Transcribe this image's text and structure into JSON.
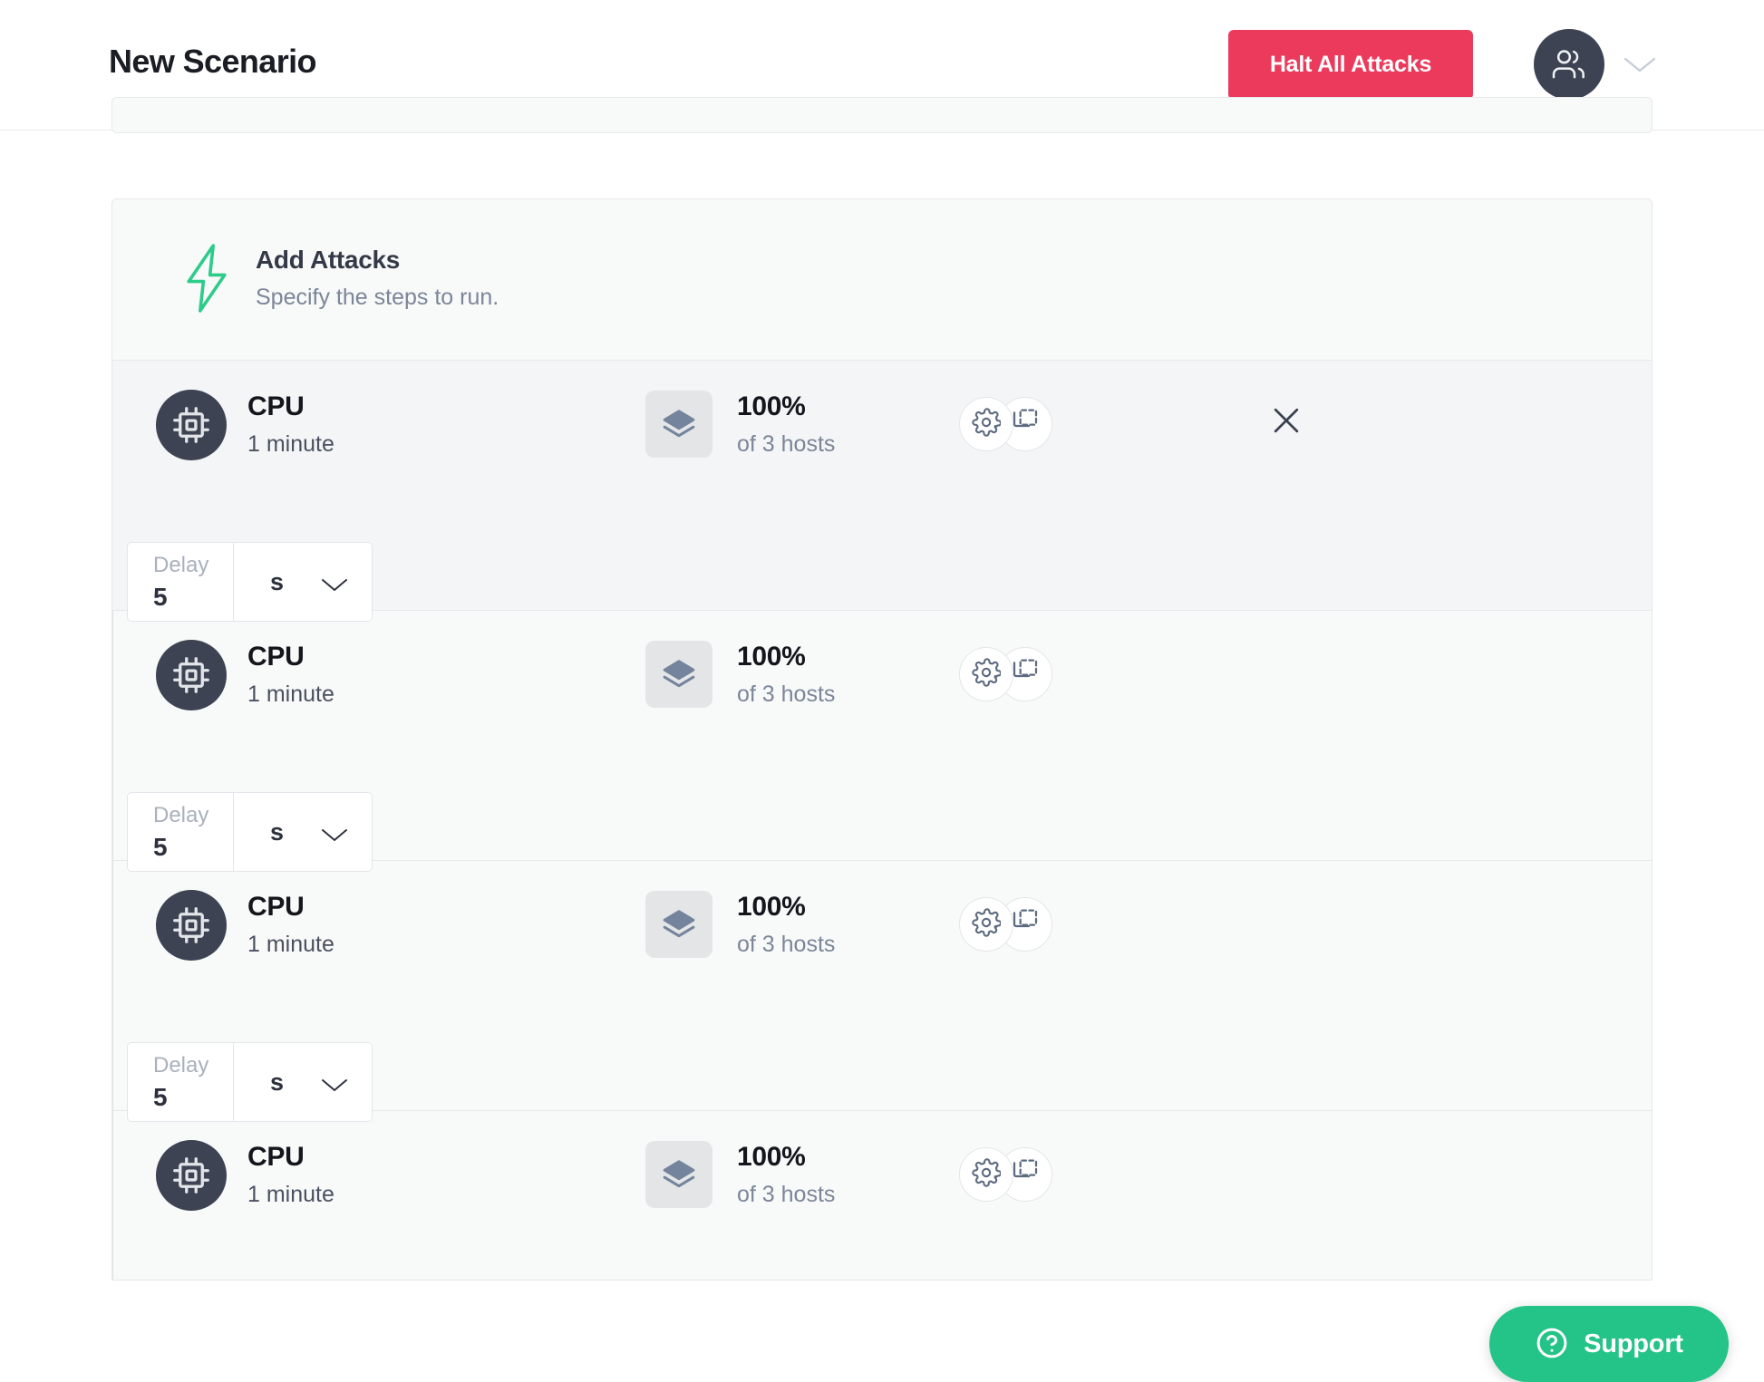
{
  "header": {
    "title": "New Scenario",
    "halt_button_label": "Halt All Attacks",
    "halt_button_color": "#eb3a5c",
    "avatar_icon": "users-icon",
    "avatar_color": "#3d4353",
    "caret_icon": "chevron-down-icon"
  },
  "add_attacks": {
    "icon": "lightning-bolt-icon",
    "icon_color": "#2ecb8b",
    "title": "Add Attacks",
    "subtitle": "Specify the steps to run."
  },
  "steps": [
    {
      "attack_icon": "cpu-chip-icon",
      "name": "CPU",
      "duration": "1 minute",
      "scope_icon": "layers-icon",
      "scope_percent": "100%",
      "scope_sub": "of 3 hosts",
      "settings_icon": "gear-icon",
      "duplicate_icon": "copy-icon",
      "remove_icon": "close-icon",
      "has_remove": true,
      "highlight": true,
      "delay": {
        "label": "Delay",
        "value": "5",
        "unit": "s",
        "caret_icon": "chevron-down-icon"
      }
    },
    {
      "attack_icon": "cpu-chip-icon",
      "name": "CPU",
      "duration": "1 minute",
      "scope_icon": "layers-icon",
      "scope_percent": "100%",
      "scope_sub": "of 3 hosts",
      "settings_icon": "gear-icon",
      "duplicate_icon": "copy-icon",
      "remove_icon": "close-icon",
      "has_remove": false,
      "highlight": false,
      "delay": {
        "label": "Delay",
        "value": "5",
        "unit": "s",
        "caret_icon": "chevron-down-icon"
      }
    },
    {
      "attack_icon": "cpu-chip-icon",
      "name": "CPU",
      "duration": "1 minute",
      "scope_icon": "layers-icon",
      "scope_percent": "100%",
      "scope_sub": "of 3 hosts",
      "settings_icon": "gear-icon",
      "duplicate_icon": "copy-icon",
      "remove_icon": "close-icon",
      "has_remove": false,
      "highlight": false,
      "delay": {
        "label": "Delay",
        "value": "5",
        "unit": "s",
        "caret_icon": "chevron-down-icon"
      }
    },
    {
      "attack_icon": "cpu-chip-icon",
      "name": "CPU",
      "duration": "1 minute",
      "scope_icon": "layers-icon",
      "scope_percent": "100%",
      "scope_sub": "of 3 hosts",
      "settings_icon": "gear-icon",
      "duplicate_icon": "copy-icon",
      "remove_icon": "close-icon",
      "has_remove": false,
      "highlight": false,
      "delay": null
    }
  ],
  "support": {
    "label": "Support",
    "icon": "question-circle-icon",
    "color": "#24c387"
  }
}
